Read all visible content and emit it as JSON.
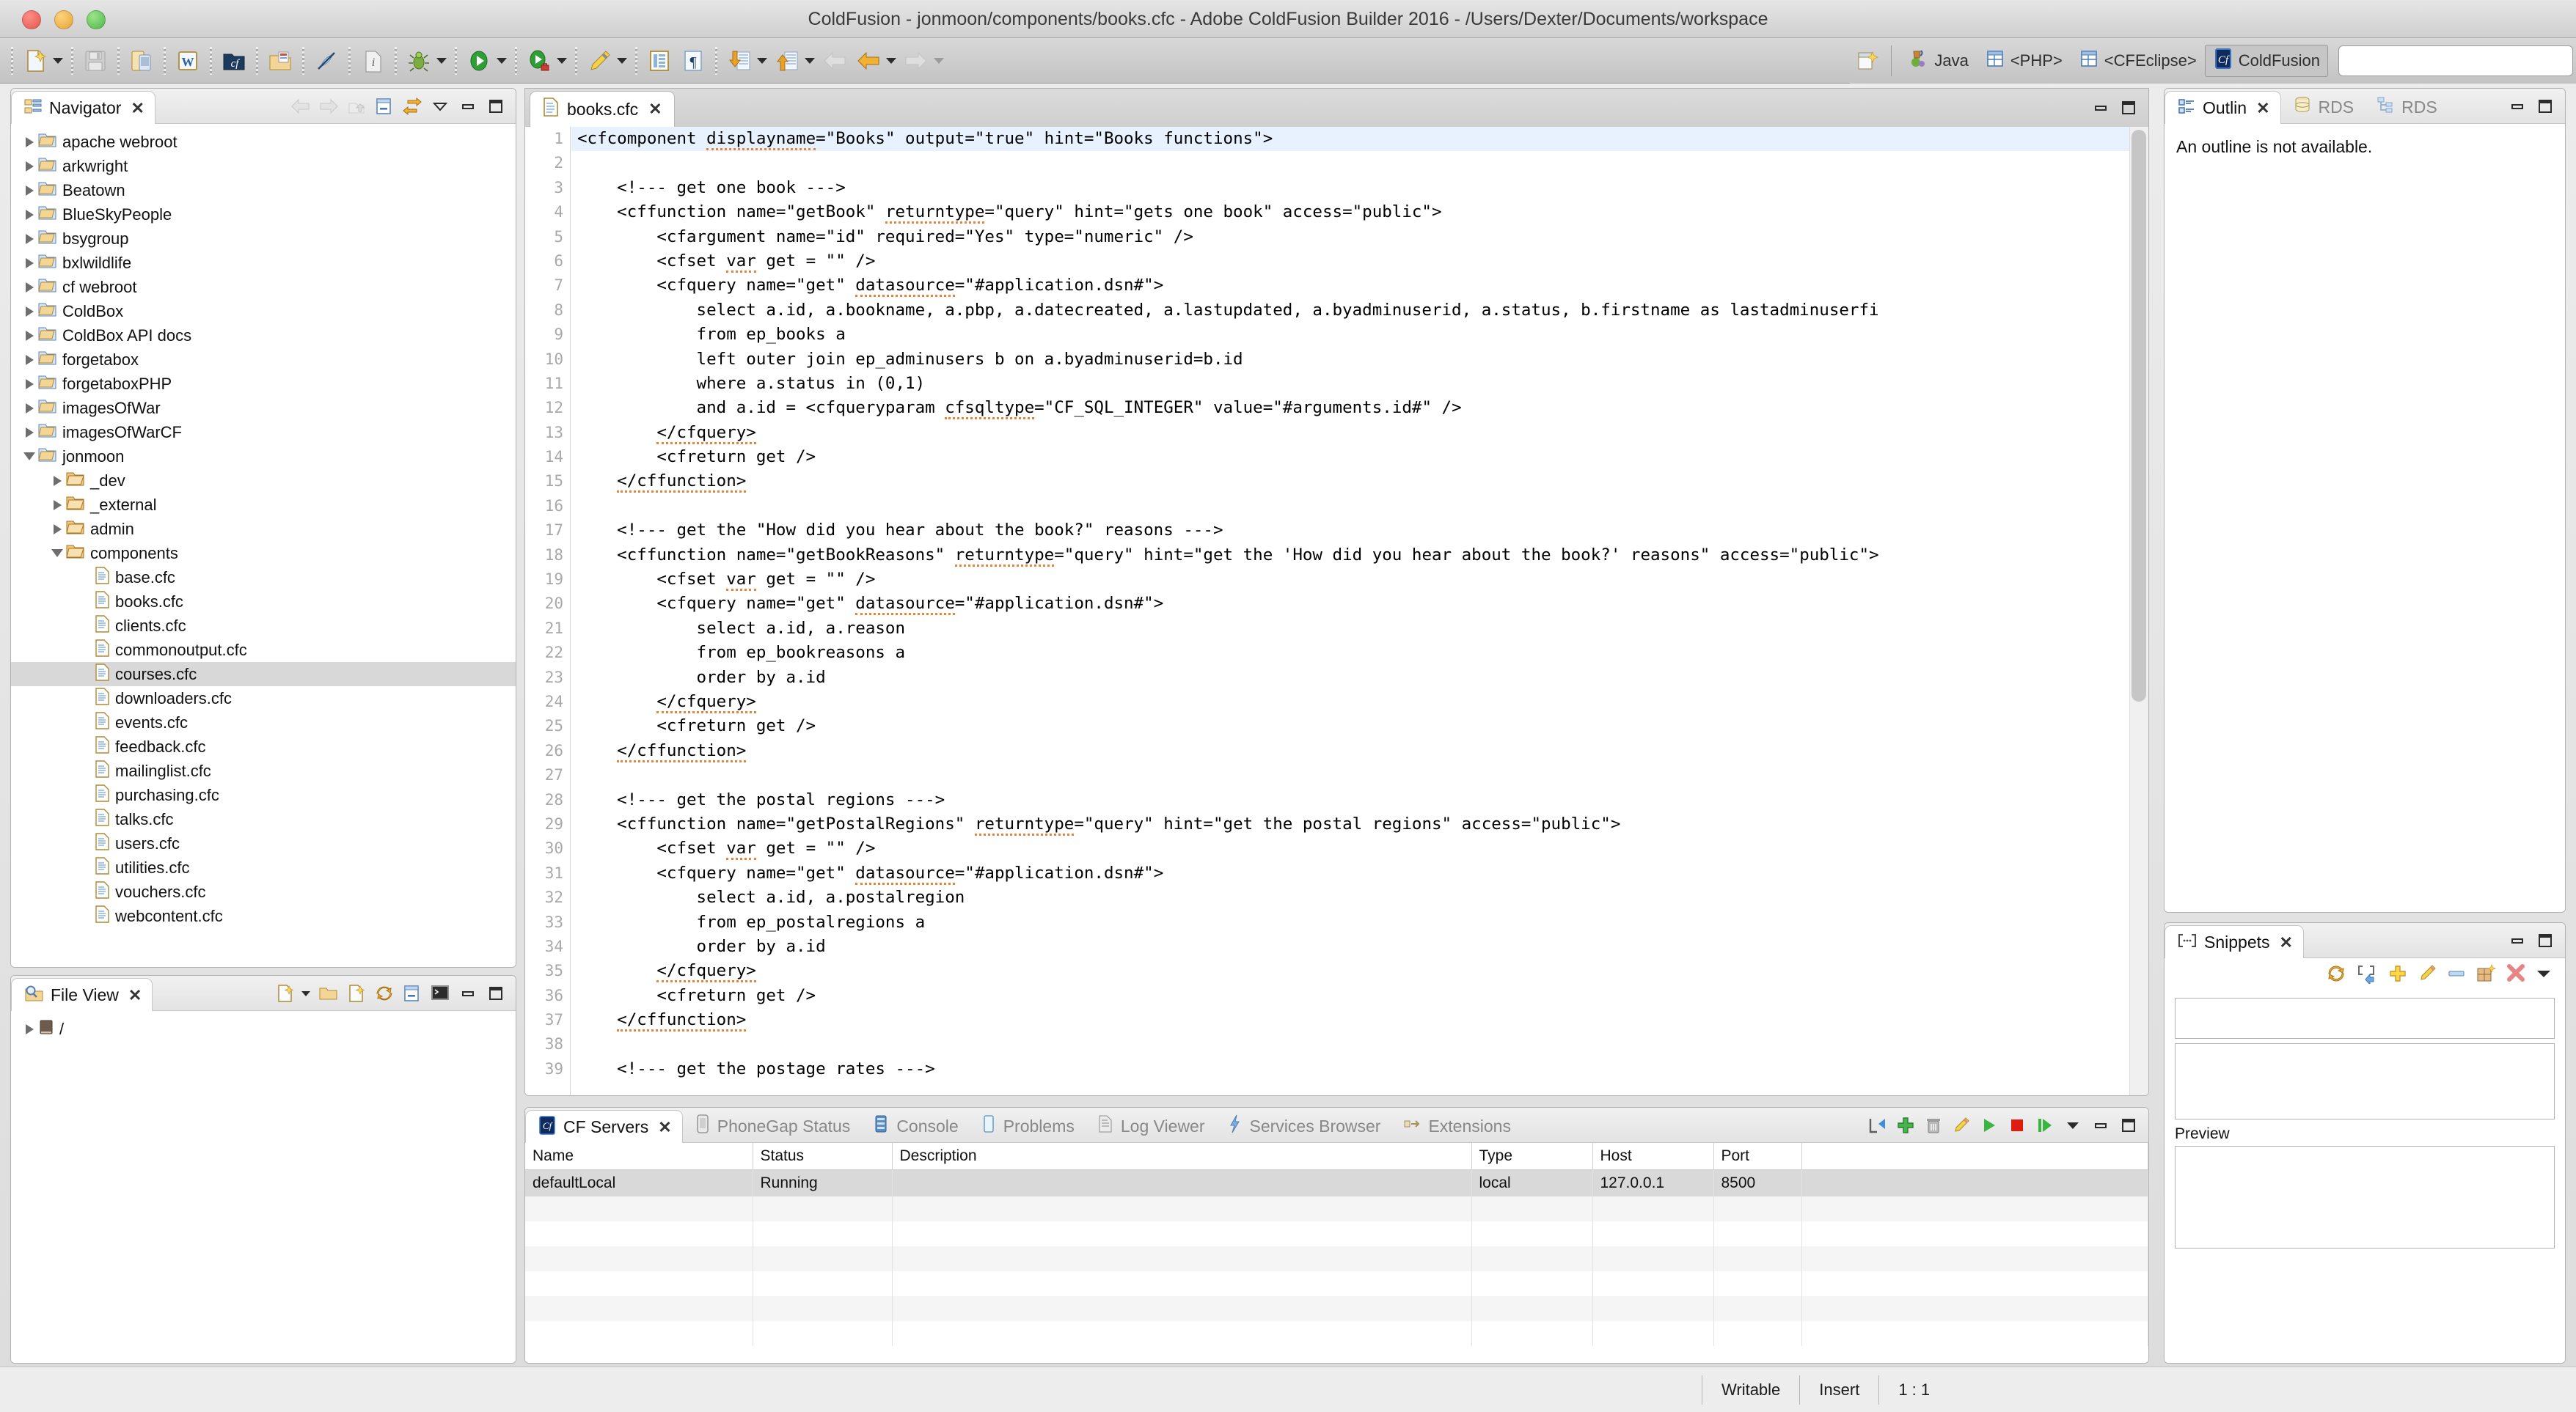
{
  "window": {
    "title": "ColdFusion - jonmoon/components/books.cfc - Adobe ColdFusion Builder 2016 - /Users/Dexter/Documents/workspace",
    "traffic_lights": [
      "close",
      "minimize",
      "zoom"
    ]
  },
  "toolbar": {
    "items": [
      {
        "icon": "new-file-icon",
        "has_menu": true
      },
      {
        "icon": "save-icon",
        "has_menu": false
      },
      {
        "icon": "mobile-device-icon",
        "has_menu": false
      },
      {
        "icon": "wysiwyg-icon",
        "has_menu": false
      },
      {
        "icon": "cf-folder-icon",
        "has_menu": false
      },
      {
        "icon": "open-resource-icon",
        "has_menu": false
      },
      {
        "icon": "no-link-icon",
        "has_menu": false
      },
      {
        "icon": "page-info-icon",
        "has_menu": false
      },
      {
        "icon": "debug-icon",
        "has_menu": true
      },
      {
        "icon": "run-icon",
        "has_menu": true
      },
      {
        "icon": "run-server-icon",
        "has_menu": true
      },
      {
        "icon": "pencil-icon",
        "has_menu": true
      },
      {
        "icon": "table-icon",
        "has_menu": false
      },
      {
        "icon": "paragraph-icon",
        "has_menu": false
      },
      {
        "icon": "import-icon",
        "has_menu": true
      },
      {
        "icon": "export-icon",
        "has_menu": true
      },
      {
        "icon": "back-disabled-icon",
        "has_menu": false
      },
      {
        "icon": "back-icon",
        "has_menu": true
      },
      {
        "icon": "forward-icon",
        "has_menu": true
      }
    ]
  },
  "perspective": {
    "open_perspective_icon": "open-perspective-icon",
    "items": [
      {
        "label": "Java",
        "icon": "java-perspective-icon",
        "active": false
      },
      {
        "label": "<PHP>",
        "icon": "php-perspective-icon",
        "active": false
      },
      {
        "label": "<CFEclipse>",
        "icon": "cfeclipse-perspective-icon",
        "active": false
      },
      {
        "label": "ColdFusion",
        "icon": "coldfusion-perspective-icon",
        "active": true
      }
    ],
    "search_value": ""
  },
  "navigator": {
    "tab_label": "Navigator",
    "tab_icon": "navigator-icon",
    "tools": [
      "back-arrow-icon",
      "forward-arrow-icon",
      "up-arrow-icon",
      "collapse-all-icon",
      "link-with-editor-icon",
      "view-menu-icon",
      "minimize-icon",
      "maximize-icon"
    ],
    "tree": [
      {
        "label": "apache webroot",
        "indent": 1,
        "type": "project",
        "state": "closed"
      },
      {
        "label": "arkwright",
        "indent": 1,
        "type": "project",
        "state": "closed"
      },
      {
        "label": "Beatown",
        "indent": 1,
        "type": "project",
        "state": "closed"
      },
      {
        "label": "BlueSkyPeople",
        "indent": 1,
        "type": "project",
        "state": "closed"
      },
      {
        "label": "bsygroup",
        "indent": 1,
        "type": "project",
        "state": "closed"
      },
      {
        "label": "bxlwildlife",
        "indent": 1,
        "type": "project",
        "state": "closed"
      },
      {
        "label": "cf webroot",
        "indent": 1,
        "type": "project",
        "state": "closed"
      },
      {
        "label": "ColdBox",
        "indent": 1,
        "type": "project",
        "state": "closed"
      },
      {
        "label": "ColdBox API docs",
        "indent": 1,
        "type": "project",
        "state": "closed"
      },
      {
        "label": "forgetabox",
        "indent": 1,
        "type": "project",
        "state": "closed"
      },
      {
        "label": "forgetaboxPHP",
        "indent": 1,
        "type": "project",
        "state": "closed"
      },
      {
        "label": "imagesOfWar",
        "indent": 1,
        "type": "project",
        "state": "closed"
      },
      {
        "label": "imagesOfWarCF",
        "indent": 1,
        "type": "project",
        "state": "closed"
      },
      {
        "label": "jonmoon",
        "indent": 1,
        "type": "project",
        "state": "open"
      },
      {
        "label": "_dev",
        "indent": 2,
        "type": "folder",
        "state": "closed"
      },
      {
        "label": "_external",
        "indent": 2,
        "type": "folder",
        "state": "closed"
      },
      {
        "label": "admin",
        "indent": 2,
        "type": "folder",
        "state": "closed"
      },
      {
        "label": "components",
        "indent": 2,
        "type": "folder",
        "state": "open"
      },
      {
        "label": "base.cfc",
        "indent": 3,
        "type": "file",
        "state": "leaf"
      },
      {
        "label": "books.cfc",
        "indent": 3,
        "type": "file",
        "state": "leaf"
      },
      {
        "label": "clients.cfc",
        "indent": 3,
        "type": "file",
        "state": "leaf"
      },
      {
        "label": "commonoutput.cfc",
        "indent": 3,
        "type": "file",
        "state": "leaf"
      },
      {
        "label": "courses.cfc",
        "indent": 3,
        "type": "file",
        "state": "leaf",
        "selected": true
      },
      {
        "label": "downloaders.cfc",
        "indent": 3,
        "type": "file",
        "state": "leaf"
      },
      {
        "label": "events.cfc",
        "indent": 3,
        "type": "file",
        "state": "leaf"
      },
      {
        "label": "feedback.cfc",
        "indent": 3,
        "type": "file",
        "state": "leaf"
      },
      {
        "label": "mailinglist.cfc",
        "indent": 3,
        "type": "file",
        "state": "leaf"
      },
      {
        "label": "purchasing.cfc",
        "indent": 3,
        "type": "file",
        "state": "leaf"
      },
      {
        "label": "talks.cfc",
        "indent": 3,
        "type": "file",
        "state": "leaf"
      },
      {
        "label": "users.cfc",
        "indent": 3,
        "type": "file",
        "state": "leaf"
      },
      {
        "label": "utilities.cfc",
        "indent": 3,
        "type": "file",
        "state": "leaf"
      },
      {
        "label": "vouchers.cfc",
        "indent": 3,
        "type": "file",
        "state": "leaf"
      },
      {
        "label": "webcontent.cfc",
        "indent": 3,
        "type": "file",
        "state": "leaf"
      }
    ]
  },
  "file_view": {
    "tab_label": "File View",
    "tab_icon": "file-view-icon",
    "tools": [
      "new-file-icon",
      "open-folder-icon",
      "new-document-icon",
      "refresh-icon",
      "collapse-all-icon",
      "terminal-icon",
      "minimize-icon",
      "maximize-icon"
    ],
    "tree": [
      {
        "label": "/",
        "indent": 1,
        "type": "drive",
        "state": "closed"
      }
    ]
  },
  "editor": {
    "tab_label": "books.cfc",
    "tab_icon": "cfc-file-icon",
    "tools": [
      "minimize-icon",
      "maximize-icon"
    ],
    "first_line": 1,
    "lines": [
      {
        "n": 1,
        "text": "<cfcomponent displayname=\"Books\" output=\"true\" hint=\"Books functions\">",
        "highlight": true
      },
      {
        "n": 2,
        "text": ""
      },
      {
        "n": 3,
        "text": "    <!--- get one book --->"
      },
      {
        "n": 4,
        "text": "    <cffunction name=\"getBook\" returntype=\"query\" hint=\"gets one book\" access=\"public\">"
      },
      {
        "n": 5,
        "text": "        <cfargument name=\"id\" required=\"Yes\" type=\"numeric\" />"
      },
      {
        "n": 6,
        "text": "        <cfset var get = \"\" />"
      },
      {
        "n": 7,
        "text": "        <cfquery name=\"get\" datasource=\"#application.dsn#\">"
      },
      {
        "n": 8,
        "text": "            select a.id, a.bookname, a.pbp, a.datecreated, a.lastupdated, a.byadminuserid, a.status, b.firstname as lastadminuserfi"
      },
      {
        "n": 9,
        "text": "            from ep_books a"
      },
      {
        "n": 10,
        "text": "            left outer join ep_adminusers b on a.byadminuserid=b.id"
      },
      {
        "n": 11,
        "text": "            where a.status in (0,1)"
      },
      {
        "n": 12,
        "text": "            and a.id = <cfqueryparam cfsqltype=\"CF_SQL_INTEGER\" value=\"#arguments.id#\" />"
      },
      {
        "n": 13,
        "text": "        </cfquery>"
      },
      {
        "n": 14,
        "text": "        <cfreturn get />"
      },
      {
        "n": 15,
        "text": "    </cffunction>"
      },
      {
        "n": 16,
        "text": ""
      },
      {
        "n": 17,
        "text": "    <!--- get the \"How did you hear about the book?\" reasons --->"
      },
      {
        "n": 18,
        "text": "    <cffunction name=\"getBookReasons\" returntype=\"query\" hint=\"get the 'How did you hear about the book?' reasons\" access=\"public\">"
      },
      {
        "n": 19,
        "text": "        <cfset var get = \"\" />"
      },
      {
        "n": 20,
        "text": "        <cfquery name=\"get\" datasource=\"#application.dsn#\">"
      },
      {
        "n": 21,
        "text": "            select a.id, a.reason"
      },
      {
        "n": 22,
        "text": "            from ep_bookreasons a"
      },
      {
        "n": 23,
        "text": "            order by a.id"
      },
      {
        "n": 24,
        "text": "        </cfquery>"
      },
      {
        "n": 25,
        "text": "        <cfreturn get />"
      },
      {
        "n": 26,
        "text": "    </cffunction>"
      },
      {
        "n": 27,
        "text": ""
      },
      {
        "n": 28,
        "text": "    <!--- get the postal regions --->"
      },
      {
        "n": 29,
        "text": "    <cffunction name=\"getPostalRegions\" returntype=\"query\" hint=\"get the postal regions\" access=\"public\">"
      },
      {
        "n": 30,
        "text": "        <cfset var get = \"\" />"
      },
      {
        "n": 31,
        "text": "        <cfquery name=\"get\" datasource=\"#application.dsn#\">"
      },
      {
        "n": 32,
        "text": "            select a.id, a.postalregion"
      },
      {
        "n": 33,
        "text": "            from ep_postalregions a"
      },
      {
        "n": 34,
        "text": "            order by a.id"
      },
      {
        "n": 35,
        "text": "        </cfquery>"
      },
      {
        "n": 36,
        "text": "        <cfreturn get />"
      },
      {
        "n": 37,
        "text": "    </cffunction>"
      },
      {
        "n": 38,
        "text": ""
      },
      {
        "n": 39,
        "text": "    <!--- get the postage rates --->"
      }
    ]
  },
  "bottom_panel": {
    "tabs": [
      {
        "label": "CF Servers",
        "icon": "cf-servers-icon",
        "active": true
      },
      {
        "label": "PhoneGap Status",
        "icon": "phonegap-icon",
        "active": false
      },
      {
        "label": "Console",
        "icon": "console-icon",
        "active": false
      },
      {
        "label": "Problems",
        "icon": "problems-icon",
        "active": false
      },
      {
        "label": "Log Viewer",
        "icon": "log-viewer-icon",
        "active": false
      },
      {
        "label": "Services Browser",
        "icon": "services-browser-icon",
        "active": false
      },
      {
        "label": "Extensions",
        "icon": "extensions-icon",
        "active": false
      }
    ],
    "tools": [
      "import-server-icon",
      "add-server-icon",
      "delete-server-icon",
      "edit-server-icon",
      "start-server-icon",
      "stop-server-icon",
      "restart-server-icon",
      "view-menu-icon",
      "minimize-icon",
      "maximize-icon"
    ],
    "table": {
      "columns": [
        "Name",
        "Status",
        "Description",
        "Type",
        "Host",
        "Port"
      ],
      "rows": [
        {
          "cells": [
            "defaultLocal",
            "Running",
            "",
            "local",
            "127.0.0.1",
            "8500"
          ],
          "selected": true
        }
      ],
      "empty_rows": 6
    }
  },
  "outline": {
    "tabs": [
      {
        "label": "Outlin",
        "icon": "outline-icon",
        "active": true
      },
      {
        "label": "RDS",
        "icon": "rds-database-icon",
        "active": false
      },
      {
        "label": "RDS",
        "icon": "rds-fileview-icon",
        "active": false
      }
    ],
    "tools": [
      "minimize-icon",
      "maximize-icon"
    ],
    "message": "An outline is not available."
  },
  "snippets": {
    "tab_label": "Snippets",
    "tab_icon": "snippets-icon",
    "tools": [
      "minimize-icon",
      "maximize-icon"
    ],
    "action_icons": [
      "refresh-icon",
      "insert-snippet-icon",
      "new-snippet-icon",
      "edit-snippet-icon",
      "remove-icon",
      "new-folder-icon",
      "delete-icon",
      "view-menu-icon"
    ],
    "filter_value": "",
    "preview_label": "Preview"
  },
  "statusbar": {
    "writable": "Writable",
    "insert_mode": "Insert",
    "cursor_position": "1 : 1"
  },
  "colors": {
    "accent": "#3a76c4",
    "spellcheck_underline": "#e8833a",
    "selection": "#d9d9d9",
    "line_highlight": "#e8f2fe",
    "running_status": "#111111"
  }
}
